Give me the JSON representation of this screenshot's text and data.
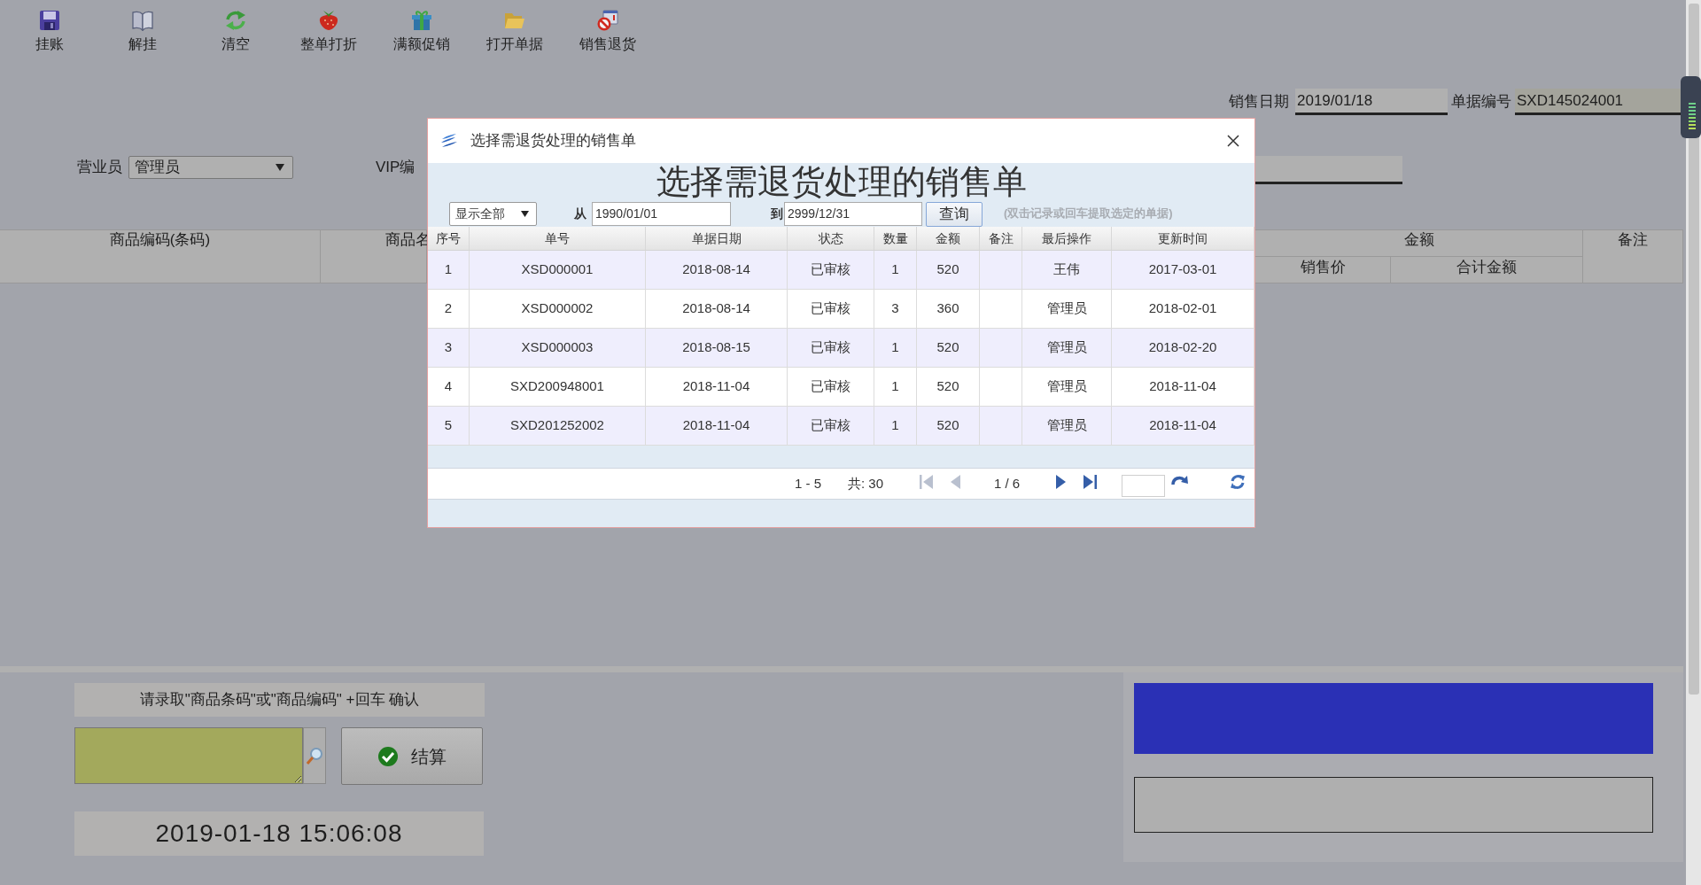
{
  "toolbar": [
    {
      "label": "挂账",
      "kind": "floppy"
    },
    {
      "label": "解挂",
      "kind": "book"
    },
    {
      "label": "清空",
      "kind": "recycle"
    },
    {
      "label": "整单打折",
      "kind": "strawberry"
    },
    {
      "label": "满额促销",
      "kind": "gift"
    },
    {
      "label": "打开单据",
      "kind": "folder"
    },
    {
      "label": "销售退货",
      "kind": "prohibit"
    }
  ],
  "header": {
    "sale_date": {
      "label": "销售日期",
      "value": "2019/01/18"
    },
    "doc_number": {
      "label": "单据编号",
      "value": "SXD145024001"
    },
    "salesperson": {
      "label": "营业员",
      "value": "管理员"
    },
    "vip": {
      "label": "VIP编"
    }
  },
  "grid": {
    "columns": [
      {
        "label": "商品编码(条码)"
      },
      {
        "label": "商品名"
      },
      {
        "label": "金额",
        "children": [
          {
            "label": "销售价"
          },
          {
            "label": "合计金额"
          }
        ]
      },
      {
        "label": "备注"
      }
    ]
  },
  "entry": {
    "prompt": "请录取\"商品条码\"或\"商品编码\" +回车 确认",
    "checkout_button": "结算",
    "clock": "2019-01-18 15:06:08"
  },
  "dialog": {
    "title": "选择需退货处理的销售单",
    "heading": "选择需退货处理的销售单",
    "filter": {
      "scope": "显示全部",
      "from_label": "从",
      "from": "1990/01/01",
      "to_label": "到",
      "to": "2999/12/31",
      "query_button": "查询",
      "hint": "(双击记录或回车提取选定的单据)"
    },
    "table": {
      "columns": [
        {
          "label": "序号"
        },
        {
          "label": "单号"
        },
        {
          "label": "单据日期"
        },
        {
          "label": "状态"
        },
        {
          "label": "数量"
        },
        {
          "label": "金额"
        },
        {
          "label": "备注"
        },
        {
          "label": "最后操作"
        },
        {
          "label": "更新时间"
        }
      ],
      "rows": [
        {
          "no": "1",
          "order_no": "XSD000001",
          "date": "2018-08-14",
          "status": "已审核",
          "qty": "1",
          "amount": "520",
          "operator": "王伟",
          "updated": "2017-03-01"
        },
        {
          "no": "2",
          "order_no": "XSD000002",
          "date": "2018-08-14",
          "status": "已审核",
          "qty": "3",
          "amount": "360",
          "operator": "管理员",
          "updated": "2018-02-01"
        },
        {
          "no": "3",
          "order_no": "XSD000003",
          "date": "2018-08-15",
          "status": "已审核",
          "qty": "1",
          "amount": "520",
          "operator": "管理员",
          "updated": "2018-02-20"
        },
        {
          "no": "4",
          "order_no": "SXD200948001",
          "date": "2018-11-04",
          "status": "已审核",
          "qty": "1",
          "amount": "520",
          "operator": "管理员",
          "updated": "2018-11-04"
        },
        {
          "no": "5",
          "order_no": "SXD201252002",
          "date": "2018-11-04",
          "status": "已审核",
          "qty": "1",
          "amount": "520",
          "operator": "管理员",
          "updated": "2018-11-04"
        }
      ]
    },
    "pager": {
      "items": [
        {
          "kind": "text",
          "text": "1 - 5"
        },
        {
          "kind": "text",
          "text": "共: 30"
        },
        {
          "kind": "first",
          "disabled": true
        },
        {
          "kind": "prev",
          "disabled": true
        },
        {
          "kind": "text",
          "text": "1 / 6"
        },
        {
          "kind": "next",
          "disabled": false
        },
        {
          "kind": "last",
          "disabled": false
        },
        {
          "kind": "page_input"
        },
        {
          "kind": "go"
        },
        {
          "kind": "refresh"
        }
      ]
    }
  }
}
